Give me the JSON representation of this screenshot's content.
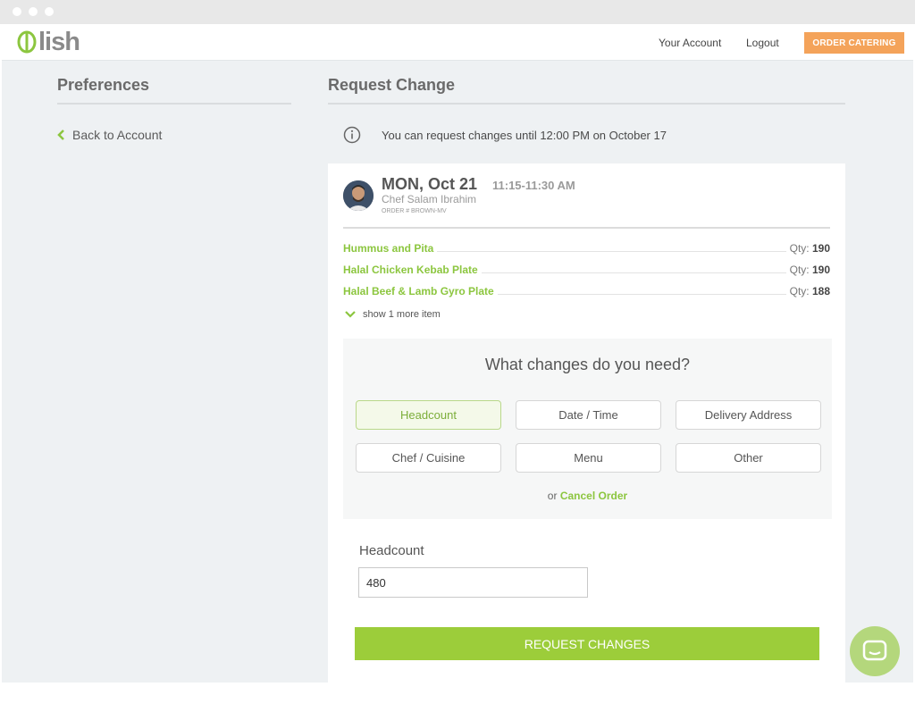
{
  "brand": {
    "logo_text": "lish",
    "accent": "#8cc63f",
    "order_button_color": "#f4a35a"
  },
  "topnav": {
    "account_link": "Your Account",
    "logout_link": "Logout",
    "order_button": "ORDER CATERING"
  },
  "sidebar": {
    "title": "Preferences",
    "back_link": "Back to Account"
  },
  "main": {
    "title": "Request Change",
    "notice": "You can request changes until 12:00 PM on October 17"
  },
  "order": {
    "date": "MON, Oct 21",
    "time": "11:15-11:30 AM",
    "chef": "Chef Salam Ibrahim",
    "order_number": "ORDER # BROWN-MV",
    "items": [
      {
        "name": "Hummus and Pita",
        "qty_label": "Qty:",
        "qty": "190"
      },
      {
        "name": "Halal Chicken Kebab Plate",
        "qty_label": "Qty:",
        "qty": "190"
      },
      {
        "name": "Halal Beef & Lamb Gyro Plate",
        "qty_label": "Qty:",
        "qty": "188"
      }
    ],
    "show_more": "show 1 more item"
  },
  "changes": {
    "question": "What changes do you need?",
    "options": [
      "Headcount",
      "Date / Time",
      "Delivery Address",
      "Chef / Cuisine",
      "Menu",
      "Other"
    ],
    "selected": "Headcount",
    "cancel_prefix": "or",
    "cancel_link": "Cancel Order"
  },
  "headcount": {
    "label": "Headcount",
    "value": "480"
  },
  "submit": {
    "label": "REQUEST CHANGES"
  }
}
